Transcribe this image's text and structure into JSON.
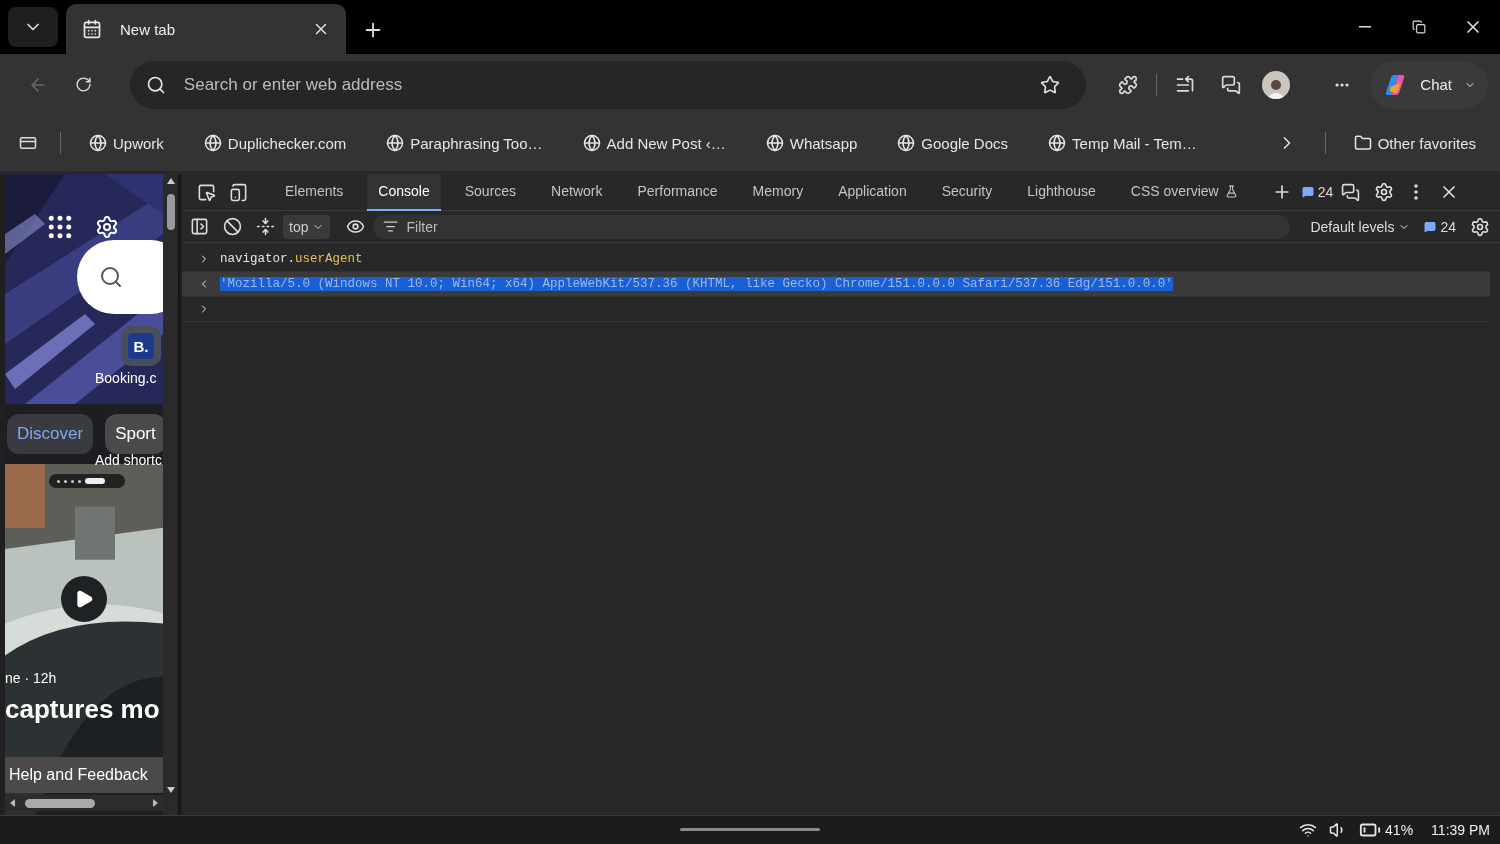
{
  "browser": {
    "tabs": [
      {
        "title": "New tab",
        "selected": true
      }
    ],
    "address_bar": {
      "placeholder": "Search or enter web address"
    },
    "copilot": {
      "label": "Chat"
    }
  },
  "favorites_bar": {
    "items": [
      {
        "label": "Upwork"
      },
      {
        "label": "Duplichecker.com"
      },
      {
        "label": "Paraphrasing Too…"
      },
      {
        "label": "Add New Post ‹…"
      },
      {
        "label": "Whatsapp"
      },
      {
        "label": "Google Docs"
      },
      {
        "label": "Temp Mail - Tem…"
      }
    ],
    "other": "Other favorites"
  },
  "page": {
    "shortcut": {
      "badge": "B.",
      "label": "Booking.c"
    },
    "feed_tabs": [
      {
        "label": "Discover",
        "selected": true
      },
      {
        "label": "Sport",
        "selected": false
      }
    ],
    "add_shortcut": "Add shortc",
    "story": {
      "meta": "ne · 12h",
      "headline": "captures mo"
    },
    "help": "Help and Feedback"
  },
  "devtools": {
    "tabs": [
      {
        "label": "Elements",
        "selected": false,
        "kind": "plain"
      },
      {
        "label": "Console",
        "selected": true,
        "kind": "plain"
      },
      {
        "label": "Sources",
        "selected": false,
        "kind": "plain"
      },
      {
        "label": "Network",
        "selected": false,
        "kind": "plain"
      },
      {
        "label": "Performance",
        "selected": false,
        "kind": "plain"
      },
      {
        "label": "Memory",
        "selected": false,
        "kind": "plain"
      },
      {
        "label": "Application",
        "selected": false,
        "kind": "plain"
      },
      {
        "label": "Security",
        "selected": false,
        "kind": "plain"
      },
      {
        "label": "Lighthouse",
        "selected": false,
        "kind": "plain"
      },
      {
        "label": "CSS overview",
        "selected": false,
        "kind": "experimental"
      }
    ],
    "issues_count": "24",
    "context": "top",
    "filter_placeholder": "Filter",
    "levels": "Default levels",
    "messages_count": "24",
    "console": [
      {
        "kind": "input",
        "object": "navigator.",
        "property": "userAgent",
        "selected": false
      },
      {
        "kind": "output",
        "text": "'Mozilla/5.0 (Windows NT 10.0; Win64; x64) AppleWebKit/537.36 (KHTML, like Gecko) Chrome/151.0.0.0 Safari/537.36 Edg/151.0.0.0'",
        "selected": true
      },
      {
        "kind": "prompt",
        "selected": false
      }
    ]
  },
  "taskbar": {
    "battery": "41%",
    "time": "11:39 PM"
  }
}
